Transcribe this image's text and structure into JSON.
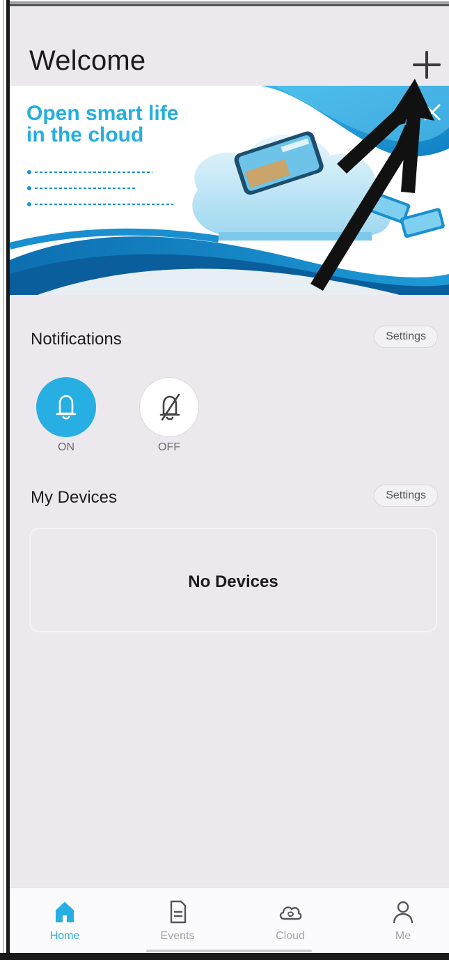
{
  "header": {
    "title": "Welcome",
    "add_icon": "plus-icon"
  },
  "banner": {
    "headline": "Open smart life\nin the cloud",
    "close_icon": "close-icon",
    "accent_color": "#25aee1"
  },
  "notifications": {
    "title": "Notifications",
    "settings_label": "Settings",
    "on": {
      "label": "ON",
      "icon": "bell-icon"
    },
    "off": {
      "label": "OFF",
      "icon": "bell-off-icon"
    }
  },
  "devices": {
    "title": "My Devices",
    "settings_label": "Settings",
    "empty_text": "No Devices"
  },
  "tabbar": {
    "tabs": [
      {
        "label": "Home",
        "icon": "home-icon",
        "active": true
      },
      {
        "label": "Events",
        "icon": "document-icon",
        "active": false
      },
      {
        "label": "Cloud",
        "icon": "cloud-icon",
        "active": false
      },
      {
        "label": "Me",
        "icon": "person-icon",
        "active": false
      }
    ]
  },
  "colors": {
    "accent": "#27aee3",
    "background": "#ebe9ee"
  }
}
